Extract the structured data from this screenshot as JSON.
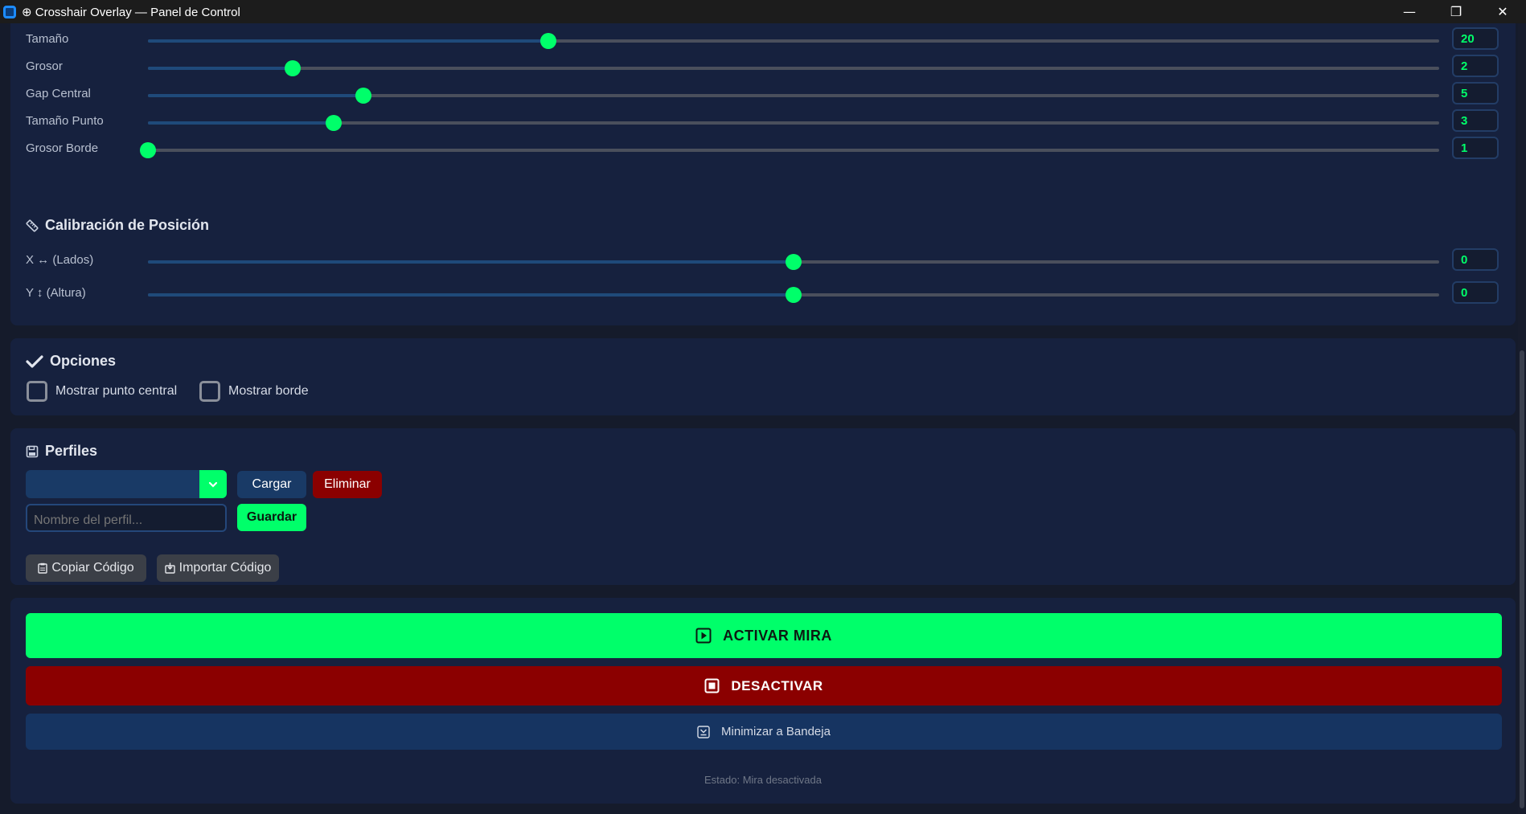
{
  "window": {
    "title": "⊕ Crosshair Overlay — Panel de Control",
    "minimize": "—",
    "restore": "❐",
    "close": "✕"
  },
  "sliders": [
    {
      "label": "Tamaño",
      "value": "20",
      "fraction": 0.31
    },
    {
      "label": "Grosor",
      "value": "2",
      "fraction": 0.112
    },
    {
      "label": "Gap Central",
      "value": "5",
      "fraction": 0.167
    },
    {
      "label": "Tamaño Punto",
      "value": "3",
      "fraction": 0.144
    },
    {
      "label": "Grosor Borde",
      "value": "1",
      "fraction": 0.0
    }
  ],
  "calibration": {
    "title": "Calibración de Posición",
    "sliders": [
      {
        "label": "X ↔ (Lados)",
        "value": "0",
        "fraction": 0.5
      },
      {
        "label": "Y ↕ (Altura)",
        "value": "0",
        "fraction": 0.5
      }
    ]
  },
  "options": {
    "title": "Opciones",
    "show_center_dot": "Mostrar punto central",
    "show_border": "Mostrar borde"
  },
  "profiles": {
    "title": "Perfiles",
    "selected": "",
    "load": "Cargar",
    "delete": "Eliminar",
    "name_placeholder": "Nombre del perfil...",
    "save": "Guardar",
    "copy_code": "Copiar Código",
    "import_code": "Importar Código"
  },
  "actions": {
    "activate": "ACTIVAR MIRA",
    "deactivate": "DESACTIVAR",
    "minimize": "Minimizar a Bandeja",
    "status": "Estado: Mira desactivada"
  },
  "colors": {
    "accent": "#00ff6a",
    "danger": "#8b0000",
    "panel": "#16213e",
    "button_blue": "#193a66"
  }
}
